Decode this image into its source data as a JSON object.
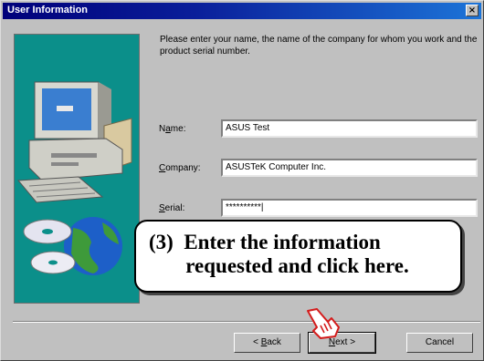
{
  "window": {
    "title": "User Information",
    "close_glyph": "×"
  },
  "prompt": "Please enter your name, the name of the company for whom you work and the product serial number.",
  "form": {
    "name": {
      "label_pre": "N",
      "label_accel": "a",
      "label_post": "me:",
      "value": "ASUS Test"
    },
    "company": {
      "label_pre": "",
      "label_accel": "C",
      "label_post": "ompany:",
      "value": "ASUSTeK Computer Inc."
    },
    "serial": {
      "label_pre": "",
      "label_accel": "S",
      "label_post": "erial:",
      "value": "**********|"
    }
  },
  "buttons": {
    "back": {
      "pre": "< ",
      "accel": "B",
      "post": "ack"
    },
    "next": {
      "pre": "",
      "accel": "N",
      "post": "ext >"
    },
    "cancel": "Cancel"
  },
  "callout": "(3)  Enter the information\n       requested and click here.",
  "icons": {
    "close": "close-icon",
    "hand": "pointing-hand-icon",
    "art": "computer-illustration"
  },
  "colors": {
    "title_bar_start": "#00007a",
    "title_bar_end": "#1c74d8",
    "art_background": "#0b8f8a",
    "dialog": "#c0c0c0",
    "hand_outline": "#d41c1c"
  }
}
